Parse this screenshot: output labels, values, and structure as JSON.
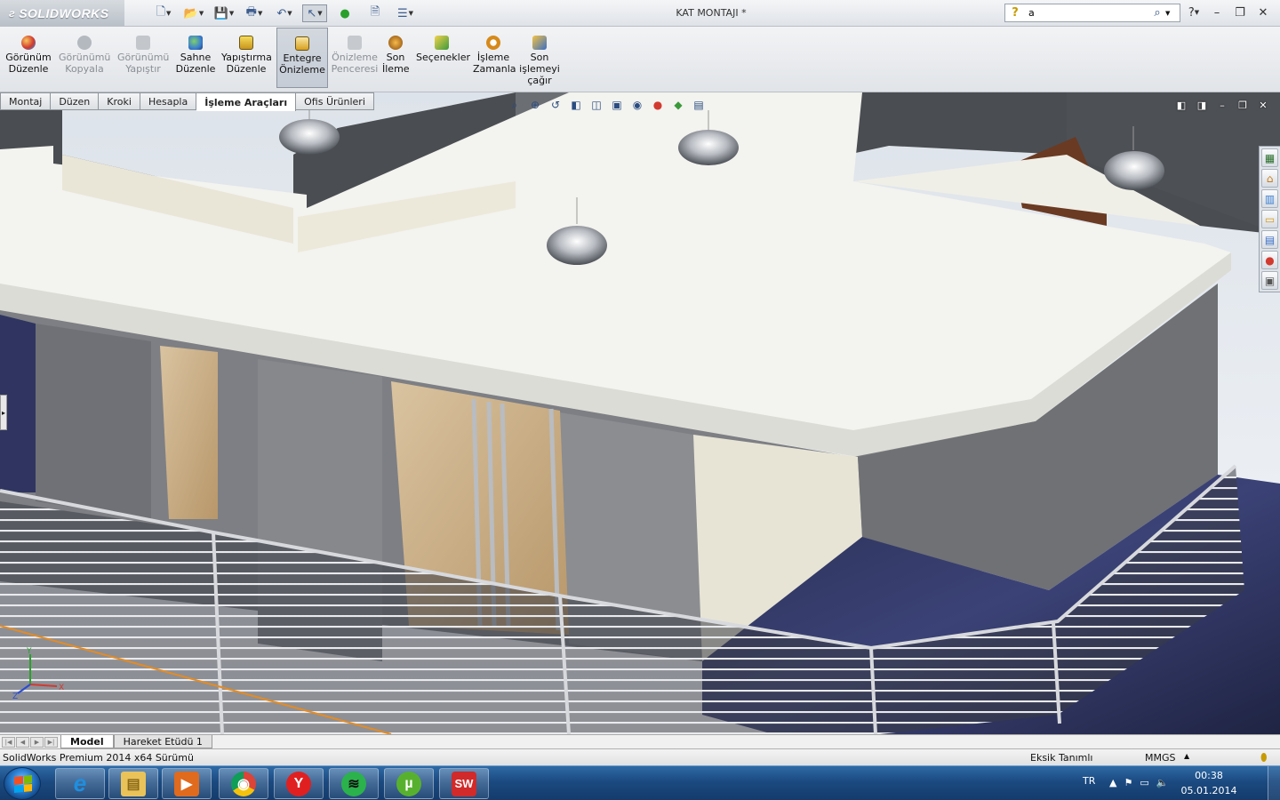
{
  "window": {
    "brand": "SOLIDWORKS",
    "doc_title": "KAT MONTAJI *",
    "search_value": "a"
  },
  "command_manager": {
    "tools": [
      {
        "label": "Görünüm Düzenle",
        "state": "enabled",
        "color": "#d23a2f"
      },
      {
        "label": "Görünümü Kopyala",
        "state": "disabled",
        "color": "#9aa0a8"
      },
      {
        "label": "Görünümü Yapıştır",
        "state": "disabled",
        "color": "#b0b5bb"
      },
      {
        "label": "Sahne Düzenle",
        "state": "enabled",
        "color": "#3a7ed1"
      },
      {
        "label": "Yapıştırma Düzenle",
        "state": "enabled",
        "color": "#e4c02a"
      },
      {
        "label": "Entegre Önizleme",
        "state": "active",
        "color": "#d6a020"
      },
      {
        "label": "Önizleme Penceresi",
        "state": "disabled",
        "color": "#a9aeb4"
      },
      {
        "label": "Son İleme",
        "state": "enabled",
        "color": "#c77a1a"
      },
      {
        "label": "Seçenekler",
        "state": "enabled",
        "color": "#3b9a3b"
      },
      {
        "label": "İşleme Zamanla",
        "state": "enabled",
        "color": "#d68a1a"
      },
      {
        "label": "Son işlemeyi çağır",
        "state": "enabled",
        "color": "#3a6ec4"
      }
    ]
  },
  "tabs": [
    {
      "label": "Montaj",
      "active": false
    },
    {
      "label": "Düzen",
      "active": false
    },
    {
      "label": "Kroki",
      "active": false
    },
    {
      "label": "Hesapla",
      "active": false
    },
    {
      "label": "İşleme Araçları",
      "active": true
    },
    {
      "label": "Ofis Ürünleri",
      "active": false
    }
  ],
  "bottom_tabs": [
    {
      "label": "Model",
      "active": true
    },
    {
      "label": "Hareket Etüdü 1",
      "active": false
    }
  ],
  "statusbar": {
    "product": "SolidWorks Premium 2014 x64 Sürümü",
    "edit_state": "Eksik Tanımlı",
    "units": "MMGS"
  },
  "triad": {
    "x": "X",
    "y": "Y",
    "z": "Z"
  },
  "taskbar": {
    "lang": "TR",
    "time": "00:38",
    "date": "05.01.2014",
    "apps": [
      {
        "name": "internet-explorer",
        "glyph": "e",
        "color": "#1e8fe0"
      },
      {
        "name": "file-explorer",
        "glyph": "▤",
        "color": "#e9c25a"
      },
      {
        "name": "media-player",
        "glyph": "▶",
        "color": "#e06a1e"
      },
      {
        "name": "chrome",
        "glyph": "◉",
        "color": "#3aa24a"
      },
      {
        "name": "yandex",
        "glyph": "Y",
        "color": "#e02020"
      },
      {
        "name": "spotify",
        "glyph": "≋",
        "color": "#2bb24c"
      },
      {
        "name": "utorrent",
        "glyph": "µ",
        "color": "#58b12e"
      },
      {
        "name": "solidworks",
        "glyph": "SW",
        "color": "#d12a2a"
      }
    ]
  }
}
